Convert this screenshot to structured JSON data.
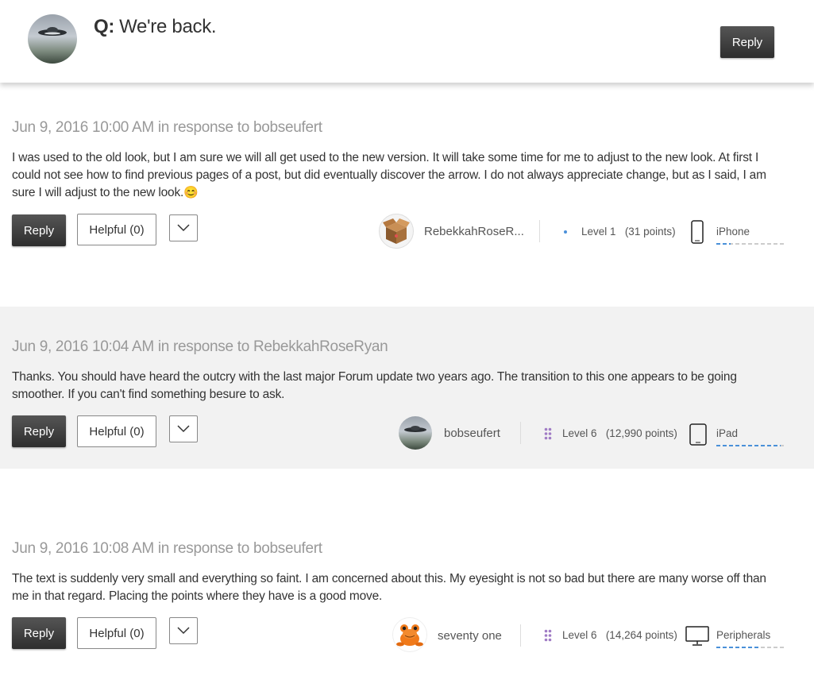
{
  "question": {
    "prefix": "Q:",
    "title": "We're back.",
    "reply_label": "Reply"
  },
  "posts": [
    {
      "meta": "Jun 9, 2016 10:00 AM in response to bobseufert",
      "body": "I was used to the old look, but I am sure we will all get used to the new version.  It will take some time for me to adjust to the new look.  At first I could not see how to find previous pages of a post, but did eventually discover the arrow.  I do not always appreciate change, but as I said, I am sure I will adjust to the new look.",
      "emoji": "😊",
      "reply_label": "Reply",
      "helpful_label": "Helpful (0)",
      "author": "RebekkahRoseR...",
      "level": "Level 1",
      "points": "(31 points)",
      "device": "iPhone",
      "device_progress": 0.2
    },
    {
      "meta": "Jun 9, 2016 10:04 AM in response to RebekkahRoseRyan",
      "body": "Thanks. You should have heard the outcry with the last major Forum update two years ago. The transition to this one appears to be going smoother. If you can't find something besure to ask.",
      "reply_label": "Reply",
      "helpful_label": "Helpful (0)",
      "author": "bobseufert",
      "level": "Level 6",
      "points": "(12,990 points)",
      "device": "iPad",
      "device_progress": 0.92
    },
    {
      "meta": "Jun 9, 2016 10:08 AM in response to bobseufert",
      "body": "The text is suddenly very small and everything so faint.   I am concerned about this.   My eyesight is not so bad but there are many worse off than me in that regard.   Placing the points where they have is a good move.",
      "reply_label": "Reply",
      "helpful_label": "Helpful (0)",
      "author": "seventy one",
      "level": "Level 6",
      "points": "(14,264 points)",
      "device": "Peripherals",
      "device_progress": 0.6
    }
  ],
  "colors": {
    "accent": "#4a90d9",
    "level_dot": "#4a90d9",
    "level6_dots": "#a07cc5",
    "alt_bg": "#f2f2f2"
  },
  "icons": [
    "ufo-avatar-icon",
    "box-avatar-icon",
    "frog-avatar-icon",
    "chevron-down-icon",
    "iphone-icon",
    "ipad-icon",
    "monitor-icon"
  ]
}
